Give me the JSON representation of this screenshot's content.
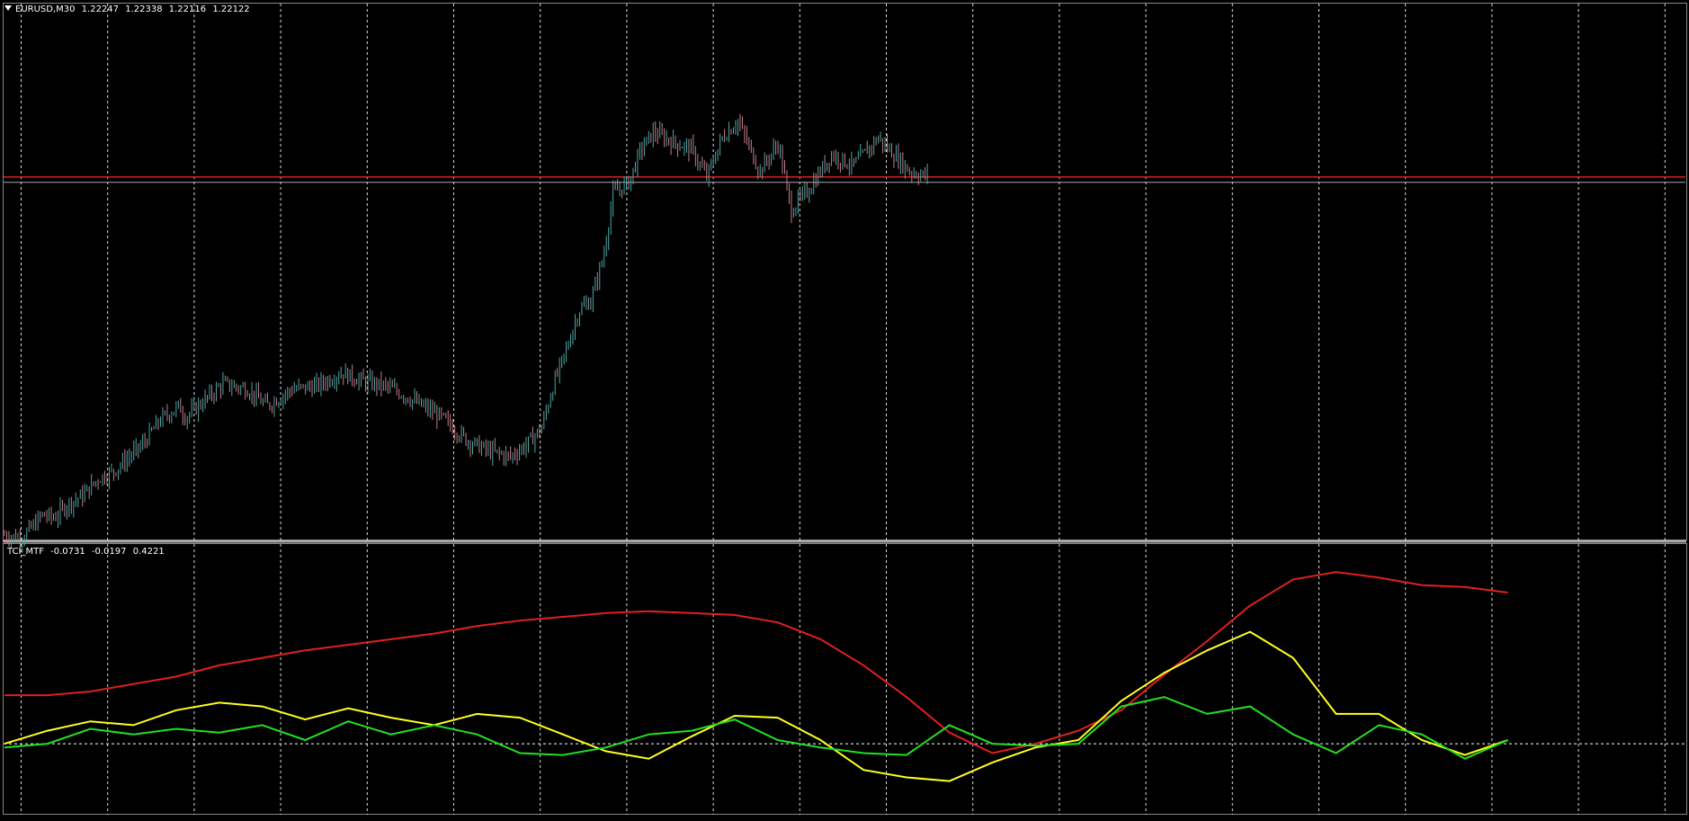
{
  "symbol": "EURUSD,M30",
  "ohlc": {
    "open": "1.22247",
    "high": "1.22338",
    "low": "1.22116",
    "close": "1.22122"
  },
  "indicator": {
    "name": "TCI_MTF",
    "v1": "-0.0731",
    "v2": "-0.0197",
    "v3": "0.4221"
  },
  "colors": {
    "background": "#000000",
    "grid": "#ffffff",
    "bull": "#4fa6a6",
    "bear": "#c07f8a",
    "red": "#e02020",
    "yellow": "#ffff22",
    "green": "#22e022",
    "hline": "#d02020"
  },
  "chart_data": [
    {
      "type": "candlestick",
      "title": "EURUSD,M30",
      "x_steps": 175,
      "y_range": [
        1.189,
        1.237
      ],
      "horizontal_line": 1.2215,
      "price_path": [
        [
          0,
          1.1895
        ],
        [
          5,
          1.1892
        ],
        [
          9,
          1.1902
        ],
        [
          12,
          1.1913
        ],
        [
          16,
          1.191
        ],
        [
          20,
          1.1922
        ],
        [
          25,
          1.193
        ],
        [
          30,
          1.1945
        ],
        [
          35,
          1.1952
        ],
        [
          40,
          1.1965
        ],
        [
          44,
          1.1975
        ],
        [
          50,
          1.1998
        ],
        [
          56,
          1.201
        ],
        [
          58,
          1.2
        ],
        [
          64,
          1.2015
        ],
        [
          70,
          1.203
        ],
        [
          78,
          1.2025
        ],
        [
          84,
          1.201
        ],
        [
          92,
          1.2025
        ],
        [
          100,
          1.2028
        ],
        [
          108,
          1.204
        ],
        [
          115,
          1.2032
        ],
        [
          122,
          1.2028
        ],
        [
          128,
          1.202
        ],
        [
          140,
          1.2
        ],
        [
          148,
          1.198
        ],
        [
          155,
          1.197
        ],
        [
          162,
          1.1965
        ],
        [
          167,
          1.1975
        ],
        [
          172,
          1.199
        ],
        [
          176,
          1.203
        ],
        [
          180,
          1.206
        ],
        [
          184,
          1.2095
        ],
        [
          188,
          1.2105
        ],
        [
          192,
          1.2145
        ],
        [
          195,
          1.22
        ],
        [
          200,
          1.221
        ],
        [
          204,
          1.224
        ],
        [
          208,
          1.2255
        ],
        [
          215,
          1.2245
        ],
        [
          220,
          1.224
        ],
        [
          225,
          1.2215
        ],
        [
          230,
          1.225
        ],
        [
          235,
          1.2265
        ],
        [
          242,
          1.222
        ],
        [
          248,
          1.2245
        ],
        [
          252,
          1.2185
        ],
        [
          258,
          1.2205
        ],
        [
          265,
          1.2235
        ],
        [
          272,
          1.2225
        ],
        [
          280,
          1.225
        ],
        [
          290,
          1.222
        ],
        [
          296,
          1.2215
        ]
      ]
    },
    {
      "type": "line",
      "title": "TCI_MTF",
      "y_range": [
        -0.38,
        1.07
      ],
      "zero_line": 0,
      "series": [
        {
          "color": "#e02020",
          "x": [
            0,
            8,
            16,
            24,
            32,
            40,
            48,
            56,
            64,
            72,
            80,
            88,
            96,
            104,
            112,
            120,
            128,
            136,
            144,
            152,
            160,
            168,
            176,
            184,
            192,
            200,
            208,
            216,
            224,
            232,
            240,
            248,
            256,
            264,
            272,
            280
          ],
          "values": [
            0.26,
            0.26,
            0.28,
            0.32,
            0.36,
            0.42,
            0.46,
            0.5,
            0.53,
            0.56,
            0.59,
            0.63,
            0.66,
            0.68,
            0.7,
            0.71,
            0.7,
            0.69,
            0.65,
            0.56,
            0.42,
            0.25,
            0.06,
            -0.05,
            0.0,
            0.07,
            0.18,
            0.37,
            0.55,
            0.74,
            0.88,
            0.92,
            0.89,
            0.85,
            0.84,
            0.81
          ]
        },
        {
          "color": "#ffff22",
          "x": [
            0,
            8,
            16,
            24,
            32,
            40,
            48,
            56,
            64,
            72,
            80,
            88,
            96,
            104,
            112,
            120,
            128,
            136,
            144,
            152,
            160,
            168,
            176,
            184,
            192,
            200,
            208,
            216,
            224,
            232,
            240,
            248,
            256,
            264,
            272,
            280
          ],
          "values": [
            0.0,
            0.07,
            0.12,
            0.1,
            0.18,
            0.22,
            0.2,
            0.13,
            0.19,
            0.14,
            0.1,
            0.16,
            0.14,
            0.05,
            -0.04,
            -0.08,
            0.04,
            0.15,
            0.14,
            0.02,
            -0.14,
            -0.18,
            -0.2,
            -0.1,
            -0.02,
            0.02,
            0.23,
            0.38,
            0.5,
            0.6,
            0.46,
            0.16,
            0.16,
            0.02,
            -0.06,
            0.02
          ]
        },
        {
          "color": "#22e022",
          "x": [
            0,
            8,
            16,
            24,
            32,
            40,
            48,
            56,
            64,
            72,
            80,
            88,
            96,
            104,
            112,
            120,
            128,
            136,
            144,
            152,
            160,
            168,
            176,
            184,
            192,
            200,
            208,
            216,
            224,
            232,
            240,
            248,
            256,
            264,
            272,
            280
          ],
          "values": [
            -0.02,
            0.0,
            0.08,
            0.05,
            0.08,
            0.06,
            0.1,
            0.02,
            0.12,
            0.05,
            0.1,
            0.05,
            -0.05,
            -0.06,
            -0.02,
            0.05,
            0.07,
            0.13,
            0.02,
            -0.02,
            -0.05,
            -0.06,
            0.1,
            0.0,
            -0.01,
            0.0,
            0.2,
            0.25,
            0.16,
            0.2,
            0.05,
            -0.05,
            0.1,
            0.05,
            -0.08,
            0.02
          ]
        }
      ]
    }
  ]
}
